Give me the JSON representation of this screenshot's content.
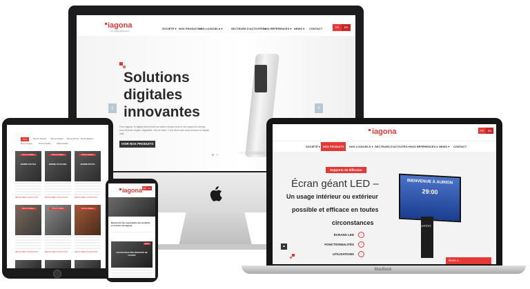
{
  "brand": {
    "name": "iagona",
    "tagline": "Your mobile digital partner",
    "accent": "#e53935"
  },
  "nav": {
    "items": [
      "SOCIÉTÉ ▾",
      "NOS PRODUITS ▾",
      "NOS LOGICIELS ▾",
      "SECTEURS D'ACTIVITÉS ▾",
      "NOS RÉFÉRENCES ▾",
      "NEWS ▾",
      "CONTACT"
    ],
    "lang": [
      "FR",
      "EN"
    ]
  },
  "imac": {
    "hero_line1": "Solutions",
    "hero_line2": "digitales",
    "hero_line3": "innovantes",
    "hero_desc": "Pour Iagona, le digital prend toute sa valeur lorsque plus le des quand du design pour devenir simple, végétales. Nos en faire. C'est alors que nous rendons le digital utile.",
    "cta": "VOIR NOS PRODUITS",
    "prev": "‹",
    "next": "›",
    "apple": ""
  },
  "macbook": {
    "active_nav": "NOS PRODUITS",
    "tag": "Supports de diffusion",
    "title": "Écran géant LED –",
    "sub1": "Un usage intérieur ou extérieur",
    "sub2": "possible et efficace en toutes",
    "sub3": "circonstances",
    "features": [
      "ÉCRANS LED",
      "FONCTIONNALITÉS",
      "UTILISATIONS"
    ],
    "billboard_text": "BIENVENUE À AURION",
    "billboard_time": "29:00",
    "billboard_brand": "AURION",
    "label": "MacBook",
    "cta": "Nous c...",
    "scroll_top": "▲"
  },
  "ipad": {
    "tabs": [
      "Tout",
      "Bornes d'accueil",
      "Bornes Tactiles",
      "Bornes Photos",
      "Écrans Digitaux",
      "Murs d'images",
      "Totems Tactiles",
      "Tables Tactiles"
    ],
    "cards": [
      {
        "badge": "Bornes Tactiles",
        "title": "BORNE TACTILE"
      },
      {
        "badge": "Bornes Tactiles",
        "title": "BORNE D'ACCUEIL"
      },
      {
        "badge": "Bornes Tactiles",
        "title": "BORNE PHOTO"
      },
      {
        "badge": "Bornes Tactiles",
        "title": ""
      },
      {
        "badge": "Bornes Tactiles",
        "title": ""
      },
      {
        "badge": "Bornes Tactiles",
        "title": ""
      }
    ],
    "link": "DÉCOUVREZ LA SOLUTION"
  },
  "iphone": {
    "headline": "Découvrez les nouveautés des produits et services de Iagona",
    "card_title": "LES NOUVEAUTÉS PRODUITS DE IAGONA",
    "badge": "News"
  }
}
